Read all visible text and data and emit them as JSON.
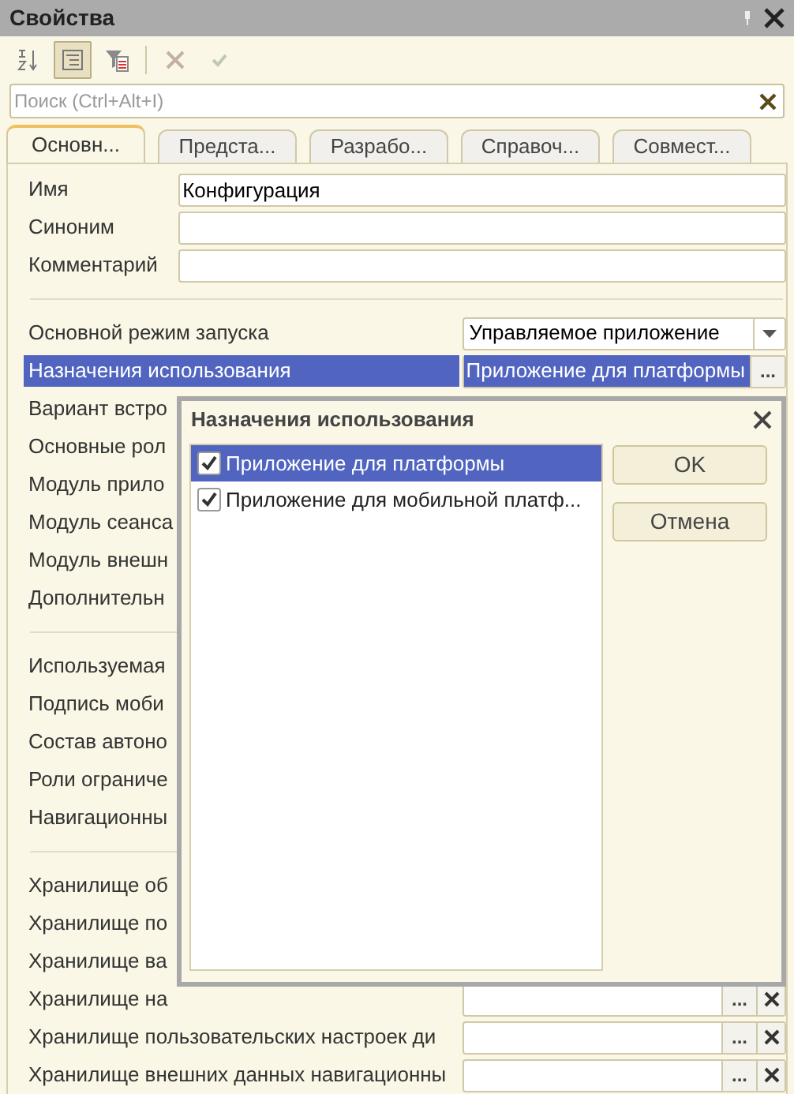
{
  "panel": {
    "title": "Свойства"
  },
  "toolbar": [
    {
      "kind": "sort",
      "selected": false,
      "disabled": false
    },
    {
      "kind": "categories",
      "selected": true,
      "disabled": false
    },
    {
      "kind": "filter",
      "selected": false,
      "disabled": false
    },
    {
      "kind": "delete",
      "selected": false,
      "disabled": true
    },
    {
      "kind": "confirm",
      "selected": false,
      "disabled": true
    }
  ],
  "search": {
    "placeholder": "Поиск (Ctrl+Alt+I)"
  },
  "tabs": [
    {
      "label": "Основн...",
      "selected": true
    },
    {
      "label": "Предста...",
      "selected": false
    },
    {
      "label": "Разрабо...",
      "selected": false
    },
    {
      "label": "Справоч...",
      "selected": false
    },
    {
      "label": "Совмест...",
      "selected": false
    }
  ],
  "sections": [
    {
      "rows": [
        {
          "label": "Имя",
          "kind": "text",
          "value": "Конфигурация",
          "selected": false
        },
        {
          "label": "Синоним",
          "kind": "text",
          "value": "",
          "selected": false
        },
        {
          "label": "Комментарий",
          "kind": "text",
          "value": "",
          "selected": false
        }
      ]
    },
    {
      "rows": [
        {
          "label": "Основной режим запуска",
          "kind": "dropdown",
          "value": "Управляемое приложение",
          "selected": false
        },
        {
          "label": "Назначения использования",
          "kind": "choice",
          "value": "Приложение для платформы",
          "button": "...",
          "clear": false,
          "selected": true
        },
        {
          "label": "Вариант встро",
          "kind": "hidden",
          "selected": false
        },
        {
          "label": "Основные рол",
          "kind": "hidden",
          "selected": false
        },
        {
          "label": "Модуль прило",
          "kind": "hidden",
          "selected": false
        },
        {
          "label": "Модуль сеанса",
          "kind": "hidden",
          "selected": false
        },
        {
          "label": "Модуль внешн",
          "kind": "hidden",
          "selected": false
        },
        {
          "label": "Дополнительн",
          "kind": "hidden",
          "selected": false
        }
      ]
    },
    {
      "rows": [
        {
          "label": "Используемая",
          "kind": "hidden",
          "selected": false
        },
        {
          "label": "Подпись моби",
          "kind": "hidden",
          "selected": false
        },
        {
          "label": "Состав автоно",
          "kind": "hidden",
          "selected": false
        },
        {
          "label": "Роли ограниче",
          "kind": "hidden",
          "selected": false
        },
        {
          "label": "Навигационны",
          "kind": "hidden",
          "selected": false
        }
      ]
    },
    {
      "rows": [
        {
          "label": "Хранилище об",
          "kind": "hidden",
          "selected": false
        },
        {
          "label": "Хранилище по",
          "kind": "hidden",
          "selected": false
        },
        {
          "label": "Хранилище ва",
          "kind": "hidden",
          "selected": false
        },
        {
          "label": "Хранилище на",
          "kind": "choice",
          "value": "",
          "button": "...",
          "clear": true,
          "selected": false
        },
        {
          "label": "Хранилище пользовательских настроек ди",
          "kind": "choice",
          "value": "",
          "button": "...",
          "clear": true,
          "selected": false
        },
        {
          "label": "Хранилище внешних данных навигационны",
          "kind": "choice",
          "value": "",
          "button": "...",
          "clear": true,
          "selected": false
        }
      ]
    }
  ],
  "dialog": {
    "title": "Назначения использования",
    "items": [
      {
        "label": "Приложение для платформы",
        "checked": true,
        "selected": true
      },
      {
        "label": "Приложение для мобильной платф...",
        "checked": true,
        "selected": false
      }
    ],
    "buttons": [
      {
        "label": "OK"
      },
      {
        "label": "Отмена"
      }
    ]
  }
}
